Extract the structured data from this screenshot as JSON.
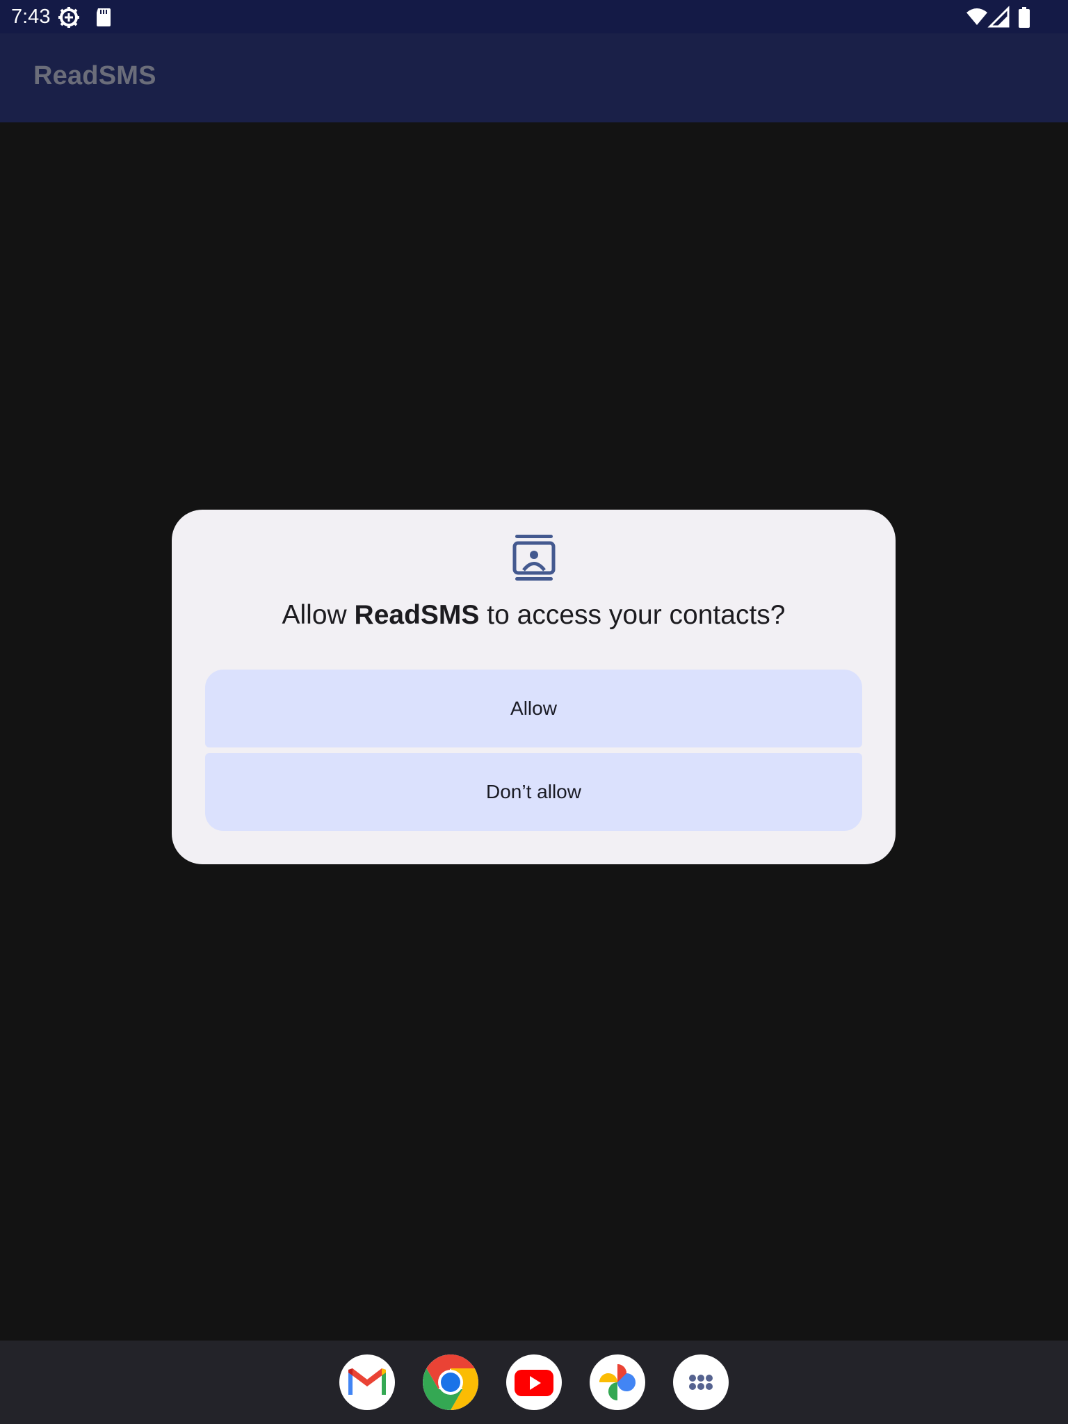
{
  "status_bar": {
    "time": "7:43",
    "left_icons": [
      "settings-gear-icon",
      "sd-card-icon"
    ],
    "right_icons": [
      "wifi-icon",
      "cellular-signal-icon",
      "battery-icon"
    ]
  },
  "app_bar": {
    "title": "ReadSMS"
  },
  "permission_dialog": {
    "icon": "contacts-icon",
    "title_prefix": "Allow ",
    "app_name": "ReadSMS",
    "title_suffix": " to access your contacts?",
    "allow_label": "Allow",
    "deny_label": "Don’t allow"
  },
  "dock": {
    "apps": [
      {
        "name": "Gmail",
        "icon": "gmail-icon"
      },
      {
        "name": "Chrome",
        "icon": "chrome-icon"
      },
      {
        "name": "YouTube",
        "icon": "youtube-icon"
      },
      {
        "name": "Photos",
        "icon": "photos-icon"
      },
      {
        "name": "App drawer",
        "icon": "app-drawer-icon"
      }
    ]
  },
  "colors": {
    "status_bar_bg": "#141a46",
    "app_bar_bg": "#1a2048",
    "dialog_bg": "#f2f0f4",
    "button_bg": "#dbe1fd",
    "accent_icon": "#44598f",
    "dock_bg": "#232329"
  }
}
